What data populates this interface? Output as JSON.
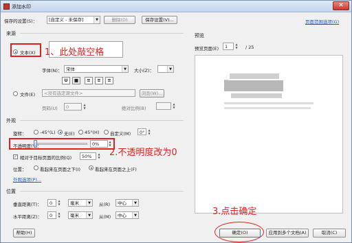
{
  "window": {
    "title": "添加水印",
    "close_glyph": "✕"
  },
  "saved_settings": {
    "label": "保存的设置(S)：",
    "value": "[自定义 - 未保存]",
    "delete_label": "删除(D)",
    "save_label": "保存设置(V)..."
  },
  "header_link": "页面范围选项(G)",
  "source": {
    "group_label": "来源",
    "text_option_label": "文本(X)",
    "font_label": "字体(N)：",
    "font_value": "宋体",
    "size_label": "大小(Z)：",
    "file_option_label": "文件(E)",
    "file_value": "<没有选定源文件>",
    "browse_label": "浏览(W)...",
    "page_label": "页码(U)",
    "page_value": "0",
    "abs_scale_label": "绝对比例(B)"
  },
  "appearance": {
    "group_label": "外观",
    "rotate_label": "旋转：",
    "rotate_neg45": "-45°(L)",
    "rotate_none": "无(E)",
    "rotate_45": "45°(H)",
    "rotate_custom": "自定义(M)",
    "rotate_value": "0°",
    "opacity_label": "不透明度(Y)：",
    "opacity_value": "0%",
    "opacity_level": 0,
    "relative_scale_label": "相对于目标页面的比例(Q)",
    "relative_scale_value": "50%",
    "position_label": "位置：",
    "position_behind": "看起来在页面之下(I)",
    "position_front": "看起来在页面之上(F)",
    "appearance_options_link": "外观选项(P)..."
  },
  "position": {
    "group_label": "位置",
    "vertical_label": "垂直距离(T)：",
    "vertical_value": "0",
    "vertical_unit": "毫米",
    "vertical_from_label": "从(R)",
    "vertical_from_value": "中心",
    "horizontal_label": "水平距离(Z)：",
    "horizontal_value": "0",
    "horizontal_unit": "毫米",
    "horizontal_from_label": "从(M)",
    "horizontal_from_value": "中心"
  },
  "preview": {
    "group_label": "预览",
    "page_label": "预览页面(E)",
    "page_value": "1",
    "page_total": "/ 25"
  },
  "footer": {
    "help_label": "帮助(H)",
    "ok_label": "确定(O)",
    "apply_multi_label": "应用到多个文档(A)",
    "cancel_label": "取消(C)"
  },
  "annotations": {
    "step1": "1、此处敲空格",
    "step2": "2.不透明度改为0",
    "step3": "3.点击确定",
    "color": "#e02020"
  }
}
